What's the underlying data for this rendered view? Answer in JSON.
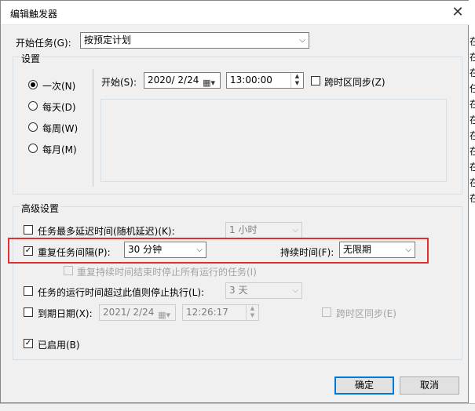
{
  "dialog": {
    "title": "编辑触发器",
    "start_task_label": "开始任务(G):",
    "start_task_value": "按预定计划",
    "settings_group": "设置",
    "advanced_group": "高级设置",
    "ok_label": "确定",
    "cancel_label": "取消"
  },
  "schedule": {
    "options": [
      "一次(N)",
      "每天(D)",
      "每周(W)",
      "每月(M)"
    ],
    "selected_index": 0,
    "start_label": "开始(S):",
    "start_date": "2020/ 2/24",
    "start_time": "13:00:00",
    "sync_label": "跨时区同步(Z)",
    "sync_checked": false
  },
  "advanced": {
    "delay_label": "任务最多延迟时间(随机延迟)(K):",
    "delay_checked": false,
    "delay_value": "1 小时",
    "repeat_label": "重复任务间隔(P):",
    "repeat_checked": true,
    "repeat_value": "30 分钟",
    "duration_label": "持续时间(F):",
    "duration_value": "无限期",
    "stop_repeat_label": "重复持续时间结束时停止所有运行的任务(I)",
    "stop_repeat_checked": false,
    "stop_if_label": "任务的运行时间超过此值则停止执行(L):",
    "stop_if_checked": false,
    "stop_if_value": "3 天",
    "expire_label": "到期日期(X):",
    "expire_checked": false,
    "expire_date": "2021/ 2/24",
    "expire_time": "12:26:17",
    "expire_sync_label": "跨时区同步(E)",
    "enabled_label": "已启用(B)",
    "enabled_checked": true
  },
  "background": {
    "right_glyphs": [
      "在",
      "在",
      "在",
      "任",
      "在",
      "在",
      "在",
      "在",
      "在",
      "在",
      "在"
    ]
  },
  "colors": {
    "highlight_box": "#e03030",
    "accent": "#0078d7"
  }
}
